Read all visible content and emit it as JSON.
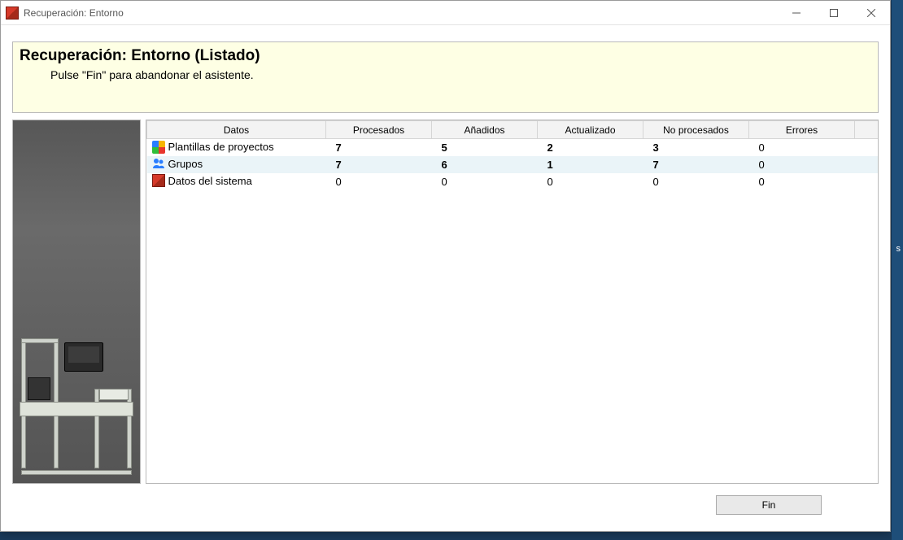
{
  "window": {
    "title": "Recuperación: Entorno"
  },
  "banner": {
    "heading": "Recuperación: Entorno (Listado)",
    "subtext": "Pulse \"Fin\" para abandonar el asistente."
  },
  "table": {
    "headers": {
      "datos": "Datos",
      "procesados": "Procesados",
      "anadidos": "Añadidos",
      "actualizado": "Actualizado",
      "no_procesados": "No procesados",
      "errores": "Errores"
    },
    "rows": [
      {
        "icon": "templates",
        "label": "Plantillas de proyectos",
        "procesados": "7",
        "anadidos": "5",
        "actualizado": "2",
        "no_procesados": "3",
        "errores": "0",
        "bold": true,
        "selected": false
      },
      {
        "icon": "groups",
        "label": "Grupos",
        "procesados": "7",
        "anadidos": "6",
        "actualizado": "1",
        "no_procesados": "7",
        "errores": "0",
        "bold": true,
        "selected": true
      },
      {
        "icon": "system",
        "label": "Datos del sistema",
        "procesados": "0",
        "anadidos": "0",
        "actualizado": "0",
        "no_procesados": "0",
        "errores": "0",
        "bold": false,
        "selected": false
      }
    ]
  },
  "footer": {
    "fin": "Fin"
  }
}
